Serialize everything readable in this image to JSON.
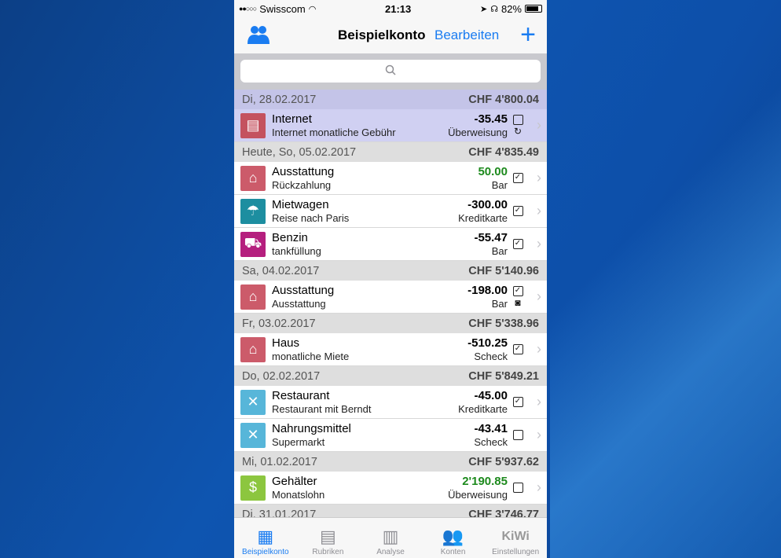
{
  "status_bar": {
    "signal": "●●○○○",
    "carrier": "Swisscom",
    "time": "21:13",
    "battery": "82%"
  },
  "nav": {
    "title": "Beispielkonto",
    "edit_label": "Bearbeiten",
    "add_label": "+"
  },
  "search": {
    "placeholder": ""
  },
  "sections": [
    {
      "date": "Di, 28.02.2017",
      "total": "CHF 4'800.04",
      "highlight": true,
      "rows": [
        {
          "title": "Internet",
          "sub": "Internet monatliche Gebühr",
          "amount": "-35.45",
          "payment": "Überweisung",
          "checked": false,
          "extra": "recurring",
          "color": "#c4525f",
          "icon": "newspaper-icon",
          "positive": false
        }
      ]
    },
    {
      "date": "Heute, So, 05.02.2017",
      "total": "CHF 4'835.49",
      "highlight": false,
      "rows": [
        {
          "title": "Ausstattung",
          "sub": "Rückzahlung",
          "amount": "50.00",
          "payment": "Bar",
          "checked": true,
          "extra": "",
          "color": "#cc5b6a",
          "icon": "house-icon",
          "positive": true
        },
        {
          "title": "Mietwagen",
          "sub": "Reise nach Paris",
          "amount": "-300.00",
          "payment": "Kreditkarte",
          "checked": true,
          "extra": "",
          "color": "#1d8ea0",
          "icon": "beach-icon",
          "positive": false
        },
        {
          "title": "Benzin",
          "sub": "tankfüllung",
          "amount": "-55.47",
          "payment": "Bar",
          "checked": true,
          "extra": "",
          "color": "#b51f7e",
          "icon": "car-icon",
          "positive": false
        }
      ]
    },
    {
      "date": "Sa, 04.02.2017",
      "total": "CHF 5'140.96",
      "highlight": false,
      "rows": [
        {
          "title": "Ausstattung",
          "sub": "Ausstattung",
          "amount": "-198.00",
          "payment": "Bar",
          "checked": true,
          "extra": "photo",
          "color": "#cc5b6a",
          "icon": "house-icon",
          "positive": false
        }
      ]
    },
    {
      "date": "Fr, 03.02.2017",
      "total": "CHF 5'338.96",
      "highlight": false,
      "rows": [
        {
          "title": "Haus",
          "sub": "monatliche Miete",
          "amount": "-510.25",
          "payment": "Scheck",
          "checked": true,
          "extra": "",
          "color": "#cc5b6a",
          "icon": "house-icon",
          "positive": false
        }
      ]
    },
    {
      "date": "Do, 02.02.2017",
      "total": "CHF 5'849.21",
      "highlight": false,
      "rows": [
        {
          "title": "Restaurant",
          "sub": "Restaurant mit Berndt",
          "amount": "-45.00",
          "payment": "Kreditkarte",
          "checked": true,
          "extra": "",
          "color": "#57b6d9",
          "icon": "utensils-icon",
          "positive": false
        },
        {
          "title": "Nahrungsmittel",
          "sub": "Supermarkt",
          "amount": "-43.41",
          "payment": "Scheck",
          "checked": false,
          "extra": "",
          "color": "#57b6d9",
          "icon": "utensils-icon",
          "positive": false
        }
      ]
    },
    {
      "date": "Mi, 01.02.2017",
      "total": "CHF 5'937.62",
      "highlight": false,
      "rows": [
        {
          "title": "Gehälter",
          "sub": "Monatslohn",
          "amount": "2'190.85",
          "payment": "Überweisung",
          "checked": false,
          "extra": "",
          "color": "#8cc63f",
          "icon": "dollar-coin-icon",
          "positive": true
        }
      ]
    },
    {
      "date": "Di, 31.01.2017",
      "total": "CHF 3'746.77",
      "highlight": false,
      "rows": []
    }
  ],
  "tabs": [
    {
      "label": "Beispielkonto",
      "icon": "calendar-icon",
      "active": true
    },
    {
      "label": "Rubriken",
      "icon": "cabinet-icon",
      "active": false
    },
    {
      "label": "Analyse",
      "icon": "bar-chart-icon",
      "active": false
    },
    {
      "label": "Konten",
      "icon": "users-icon",
      "active": false
    },
    {
      "label": "Einstellungen",
      "icon": "kiwi-icon",
      "active": false,
      "logo_text": "KiWi"
    }
  ],
  "colors": {
    "accent": "#1a7cf1",
    "positive": "#1d8a1d"
  }
}
